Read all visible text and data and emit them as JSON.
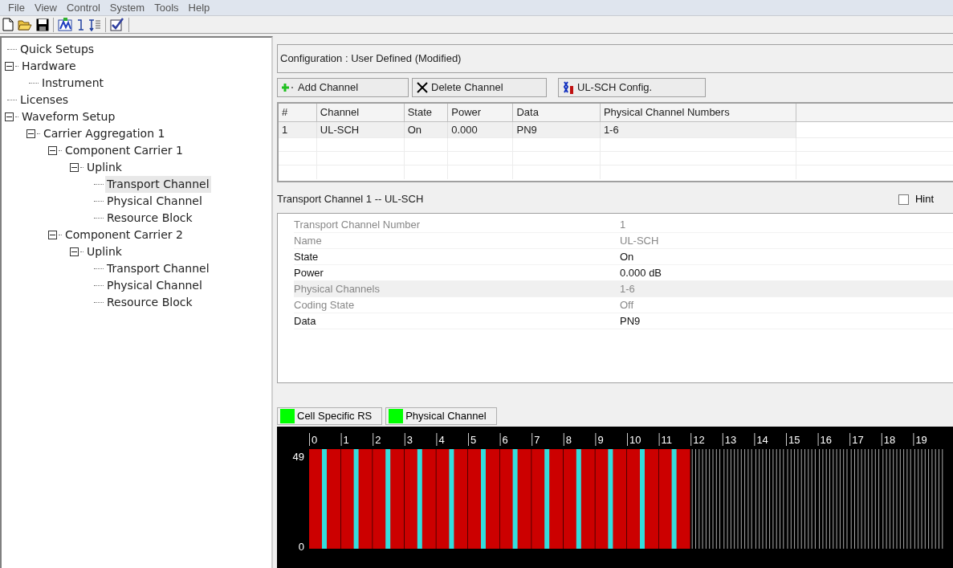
{
  "menu": [
    "File",
    "View",
    "Control",
    "System",
    "Tools",
    "Help"
  ],
  "tree": [
    {
      "label": "Quick Setups",
      "selected": false
    },
    {
      "label": "Hardware",
      "expanded": true,
      "selected": false,
      "children": [
        {
          "label": "Instrument",
          "selected": false
        }
      ]
    },
    {
      "label": "Licenses",
      "selected": false
    },
    {
      "label": "Waveform Setup",
      "expanded": true,
      "selected": false,
      "children": [
        {
          "label": "Carrier Aggregation 1",
          "expanded": true,
          "selected": false,
          "children": [
            {
              "label": "Component Carrier 1",
              "expanded": true,
              "selected": false,
              "children": [
                {
                  "label": "Uplink",
                  "expanded": true,
                  "selected": false,
                  "children": [
                    {
                      "label": "Transport Channel",
                      "selected": true
                    },
                    {
                      "label": "Physical Channel",
                      "selected": false
                    },
                    {
                      "label": "Resource Block",
                      "selected": false
                    }
                  ]
                }
              ]
            },
            {
              "label": "Component Carrier 2",
              "expanded": true,
              "selected": false,
              "children": [
                {
                  "label": "Uplink",
                  "expanded": true,
                  "selected": false,
                  "children": [
                    {
                      "label": "Transport Channel",
                      "selected": false
                    },
                    {
                      "label": "Physical Channel",
                      "selected": false
                    },
                    {
                      "label": "Resource Block",
                      "selected": false
                    }
                  ]
                }
              ]
            }
          ]
        }
      ]
    }
  ],
  "configuration": "Configuration : User Defined (Modified)",
  "buttons": [
    {
      "kind": "add",
      "label": "Add Channel"
    },
    {
      "kind": "delete",
      "label": "Delete Channel"
    },
    {
      "kind": "config",
      "label": "UL-SCH Config."
    }
  ],
  "table": {
    "columns": [
      "#",
      "Channel",
      "State",
      "Power",
      "Data",
      "Physical Channel Numbers"
    ],
    "rows": [
      {
        "cells": [
          "1",
          "UL-SCH",
          "On",
          "0.000",
          "PN9",
          "1-6"
        ],
        "selected": true
      }
    ]
  },
  "detail_title": "Transport Channel 1 -- UL-SCH",
  "hint": {
    "label": "Hint",
    "checked": false
  },
  "properties": [
    {
      "label": "Transport Channel Number",
      "value": "1",
      "disabled": true,
      "selected": false
    },
    {
      "label": "Name",
      "value": "UL-SCH",
      "disabled": true,
      "selected": false
    },
    {
      "label": "State",
      "value": "On",
      "disabled": false,
      "selected": false
    },
    {
      "label": "Power",
      "value": "0.000 dB",
      "disabled": false,
      "selected": false
    },
    {
      "label": "Physical Channels",
      "value": "1-6",
      "disabled": true,
      "selected": true
    },
    {
      "label": "Coding State",
      "value": "Off",
      "disabled": true,
      "selected": false
    },
    {
      "label": "Data",
      "value": "PN9",
      "disabled": false,
      "selected": false
    }
  ],
  "legend": [
    {
      "label": "Cell Specific RS",
      "color": "#00ff00"
    },
    {
      "label": "Physical Channel",
      "color": "#00ff00"
    }
  ],
  "resource_grid": {
    "y_labels": [
      "49",
      "0"
    ],
    "slots": [
      {
        "label": "0",
        "allocated": true
      },
      {
        "label": "1",
        "allocated": true
      },
      {
        "label": "2",
        "allocated": true
      },
      {
        "label": "3",
        "allocated": true
      },
      {
        "label": "4",
        "allocated": true
      },
      {
        "label": "5",
        "allocated": true
      },
      {
        "label": "6",
        "allocated": true
      },
      {
        "label": "7",
        "allocated": true
      },
      {
        "label": "8",
        "allocated": true
      },
      {
        "label": "9",
        "allocated": true
      },
      {
        "label": "10",
        "allocated": true
      },
      {
        "label": "11",
        "allocated": true
      },
      {
        "label": "12",
        "allocated": false
      },
      {
        "label": "13",
        "allocated": false
      },
      {
        "label": "14",
        "allocated": false
      },
      {
        "label": "15",
        "allocated": false
      },
      {
        "label": "16",
        "allocated": false
      },
      {
        "label": "17",
        "allocated": false
      },
      {
        "label": "18",
        "allocated": false
      },
      {
        "label": "19",
        "allocated": false
      }
    ]
  }
}
